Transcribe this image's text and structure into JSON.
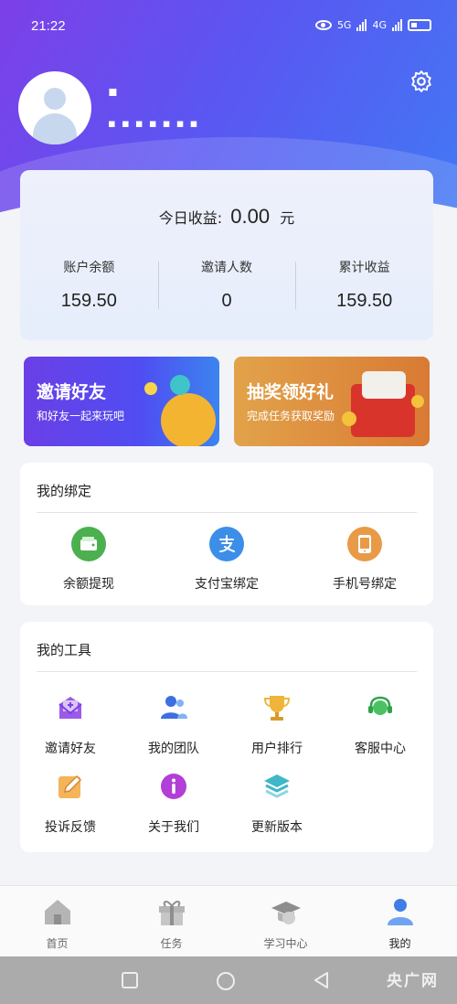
{
  "status_bar": {
    "time": "21:22",
    "net1": "5G",
    "net2": "4G"
  },
  "profile": {
    "username": "▪",
    "user_id": "▪ ▪ ▪ ▪ ▪ ▪ ▪"
  },
  "earnings": {
    "today_label": "今日收益:",
    "today_amount": "0.00",
    "today_unit": "元",
    "stats": [
      {
        "label": "账户余额",
        "value": "159.50"
      },
      {
        "label": "邀请人数",
        "value": "0"
      },
      {
        "label": "累计收益",
        "value": "159.50"
      }
    ]
  },
  "banners": {
    "invite": {
      "title": "邀请好友",
      "subtitle": "和好友一起来玩吧"
    },
    "lottery": {
      "title": "抽奖领好礼",
      "subtitle": "完成任务获取奖励"
    }
  },
  "binding": {
    "title": "我的绑定",
    "items": [
      {
        "label": "余额提现",
        "icon": "wallet-icon",
        "color": "#4cb04f"
      },
      {
        "label": "支付宝绑定",
        "icon": "alipay-icon",
        "color": "#3d8ee8"
      },
      {
        "label": "手机号绑定",
        "icon": "phone-icon",
        "color": "#e89a47"
      }
    ]
  },
  "tools": {
    "title": "我的工具",
    "items": [
      {
        "label": "邀请好友",
        "icon": "invite-mail-icon"
      },
      {
        "label": "我的团队",
        "icon": "team-icon"
      },
      {
        "label": "用户排行",
        "icon": "trophy-icon"
      },
      {
        "label": "客服中心",
        "icon": "headset-icon"
      },
      {
        "label": "投诉反馈",
        "icon": "edit-icon"
      },
      {
        "label": "关于我们",
        "icon": "info-icon"
      },
      {
        "label": "更新版本",
        "icon": "layers-icon"
      }
    ]
  },
  "tabbar": {
    "items": [
      {
        "label": "首页",
        "icon": "home-icon",
        "active": false
      },
      {
        "label": "任务",
        "icon": "gift-icon",
        "active": false
      },
      {
        "label": "学习中心",
        "icon": "graduation-cap-icon",
        "active": false
      },
      {
        "label": "我的",
        "icon": "user-icon",
        "active": true
      }
    ]
  },
  "watermark": "央广网"
}
